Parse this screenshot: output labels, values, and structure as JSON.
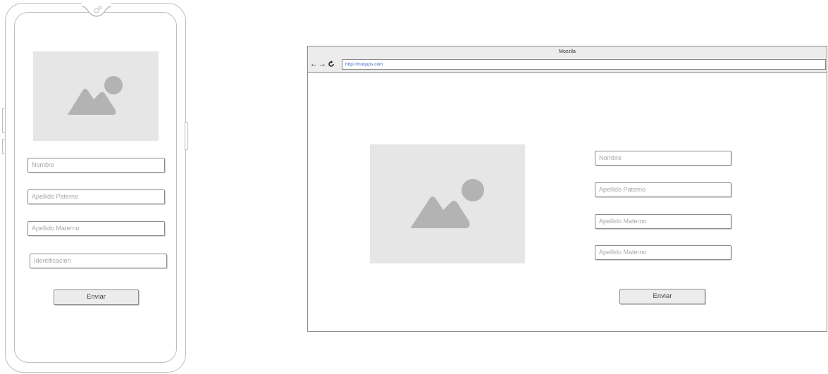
{
  "phone": {
    "form": {
      "fields": [
        {
          "placeholder": "Nombre"
        },
        {
          "placeholder": "Apellido Paterno"
        },
        {
          "placeholder": "Apellido Materno"
        },
        {
          "placeholder": "Identificación"
        }
      ],
      "submit_label": "Enviar"
    }
  },
  "browser": {
    "title": "Mozzila",
    "url": "http://moqups.com",
    "form": {
      "fields": [
        {
          "placeholder": "Nombre"
        },
        {
          "placeholder": "Apellido Paterno"
        },
        {
          "placeholder": "Apellido Materno"
        },
        {
          "placeholder": "Apellido Materno"
        }
      ],
      "submit_label": "Enviar"
    }
  },
  "icons": {
    "back": "arrow-left-icon",
    "forward": "arrow-right-icon",
    "reload": "reload-icon",
    "image_placeholder": "image-icon"
  },
  "colors": {
    "placeholder_bg": "#e6e6e6",
    "placeholder_shape": "#b3b3b3",
    "url_text": "#3b5fc0"
  }
}
